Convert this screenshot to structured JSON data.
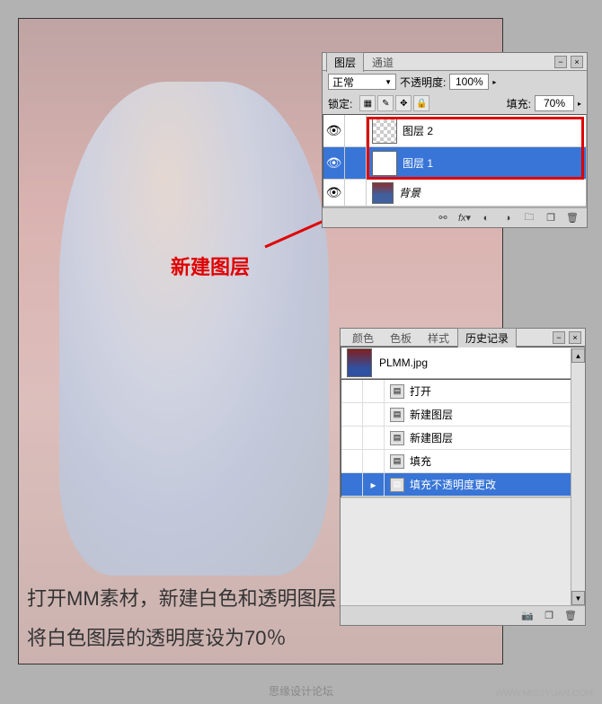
{
  "annotation": {
    "new_layer": "新建图层"
  },
  "instruction": {
    "line1": "打开MM素材，新建白色和透明图层，",
    "line2": "将白色图层的透明度设为70％"
  },
  "layers_panel": {
    "tabs": {
      "layers": "图层",
      "channels": "通道"
    },
    "blend_mode": "正常",
    "opacity_label": "不透明度:",
    "opacity_value": "100%",
    "lock_label": "锁定:",
    "fill_label": "填充:",
    "fill_value": "70%",
    "layers": [
      {
        "name": "图层 2"
      },
      {
        "name": "图层 1"
      },
      {
        "name": "背景"
      }
    ]
  },
  "history_panel": {
    "tabs": {
      "color": "颜色",
      "swatches": "色板",
      "styles": "样式",
      "history": "历史记录"
    },
    "file_name": "PLMM.jpg",
    "steps": [
      "打开",
      "新建图层",
      "新建图层",
      "填充",
      "填充不透明度更改"
    ]
  },
  "watermark": {
    "main": "思缘设计论坛",
    "url": "WWW.MISSYUAN.COM"
  }
}
